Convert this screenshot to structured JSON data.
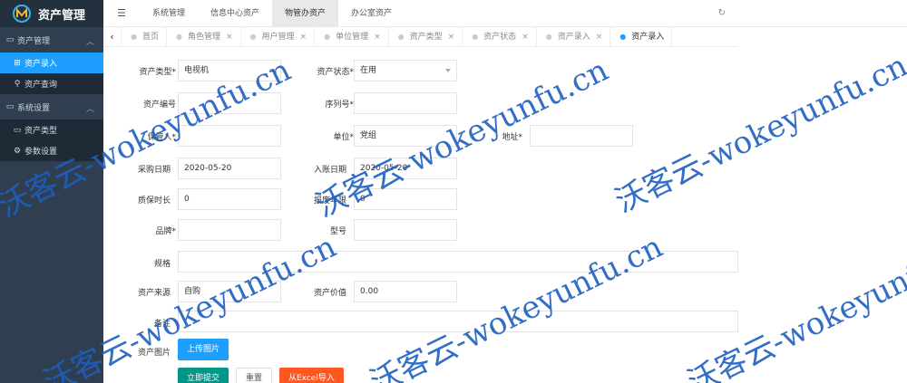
{
  "app": {
    "title": "资产管理"
  },
  "sidebar": {
    "groups": [
      {
        "label": "资产管理",
        "items": [
          {
            "label": "资产录入"
          },
          {
            "label": "资产查询"
          }
        ]
      },
      {
        "label": "系统设置",
        "items": [
          {
            "label": "资产类型"
          },
          {
            "label": "参数设置"
          }
        ]
      }
    ]
  },
  "topnav": {
    "tabs": [
      "系统管理",
      "信息中心资产",
      "物管办资产",
      "办公室资产"
    ]
  },
  "tabsbar": {
    "tabs": [
      "首页",
      "角色管理",
      "用户管理",
      "单位管理",
      "资产类型",
      "资产状态",
      "资产录入",
      "资产录入"
    ]
  },
  "form": {
    "asset_type": {
      "label": "资产类型*",
      "value": "电视机"
    },
    "asset_status": {
      "label": "资产状态*",
      "value": "在用"
    },
    "asset_code": {
      "label": "资产编号",
      "value": ""
    },
    "serial_no": {
      "label": "序列号*",
      "value": ""
    },
    "keeper": {
      "label": "保管人*",
      "value": ""
    },
    "unit": {
      "label": "单位*",
      "value": "党组"
    },
    "address": {
      "label": "地址*",
      "value": ""
    },
    "purchase_date": {
      "label": "采购日期",
      "value": "2020-05-20"
    },
    "entry_date": {
      "label": "入账日期",
      "value": "2020-05-20"
    },
    "warranty": {
      "label": "质保时长",
      "value": "0"
    },
    "scrap_years": {
      "label": "报废年限",
      "value": "0"
    },
    "brand": {
      "label": "品牌*",
      "value": ""
    },
    "model": {
      "label": "型号",
      "value": ""
    },
    "spec": {
      "label": "规格",
      "value": ""
    },
    "source": {
      "label": "资产来源",
      "value": "自购"
    },
    "price": {
      "label": "资产价值",
      "value": "0.00"
    },
    "remark": {
      "label": "备注",
      "value": ""
    },
    "image": {
      "label": "资产图片",
      "upload_label": "上传图片"
    },
    "buttons": {
      "submit": "立即提交",
      "reset": "重置",
      "import": "从Excel导入"
    }
  },
  "watermark": {
    "text": "沃客云-wokeyunfu.cn"
  },
  "colors": {
    "sidebar": "#2f3f4f",
    "accent": "#1e9fff",
    "submit": "#009688",
    "import": "#ff5722",
    "watermark": "#1e5fc0"
  },
  "icons": {
    "menu_toggle": "menu-icon",
    "refresh": "refresh-icon",
    "logo": "logo-icon"
  }
}
